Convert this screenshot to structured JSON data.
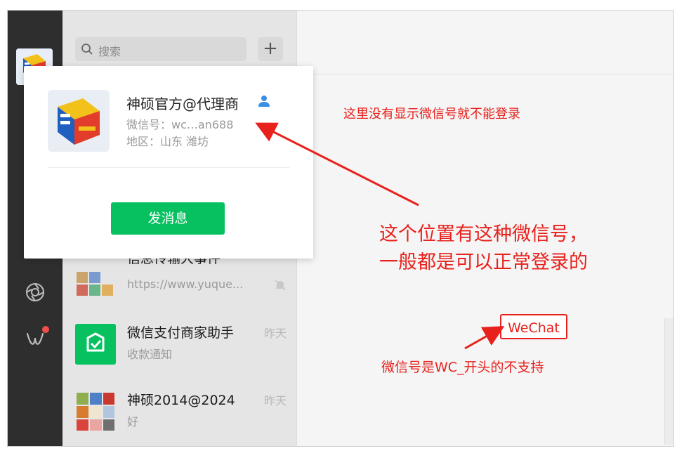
{
  "search": {
    "placeholder": "搜索",
    "add_label": "+"
  },
  "popup": {
    "name": "神硕官方@代理商",
    "wechat_id": "微信号：wc…an688",
    "region": "地区：山东 潍坊",
    "send_button": "发消息"
  },
  "chats": [
    {
      "title": "信息传输大事件",
      "preview": "https://www.yuque...",
      "time": ""
    },
    {
      "title": "微信支付商家助手",
      "preview": "收款通知",
      "time": "昨天"
    },
    {
      "title": "神硕2014@2024",
      "preview": "好",
      "time": "昨天"
    }
  ],
  "annotations": {
    "note_top": "这里没有显示微信号就不能登录",
    "note_mid_line1": "这个位置有这种微信号，",
    "note_mid_line2": "一般都是可以正常登录的",
    "wechat_label": "WeChat",
    "note_bottom": "微信号是WC_开头的不支持"
  },
  "colors": {
    "accent_green": "#07c160",
    "annotation_red": "#e8211c",
    "sidebar": "#2e2e2e"
  }
}
